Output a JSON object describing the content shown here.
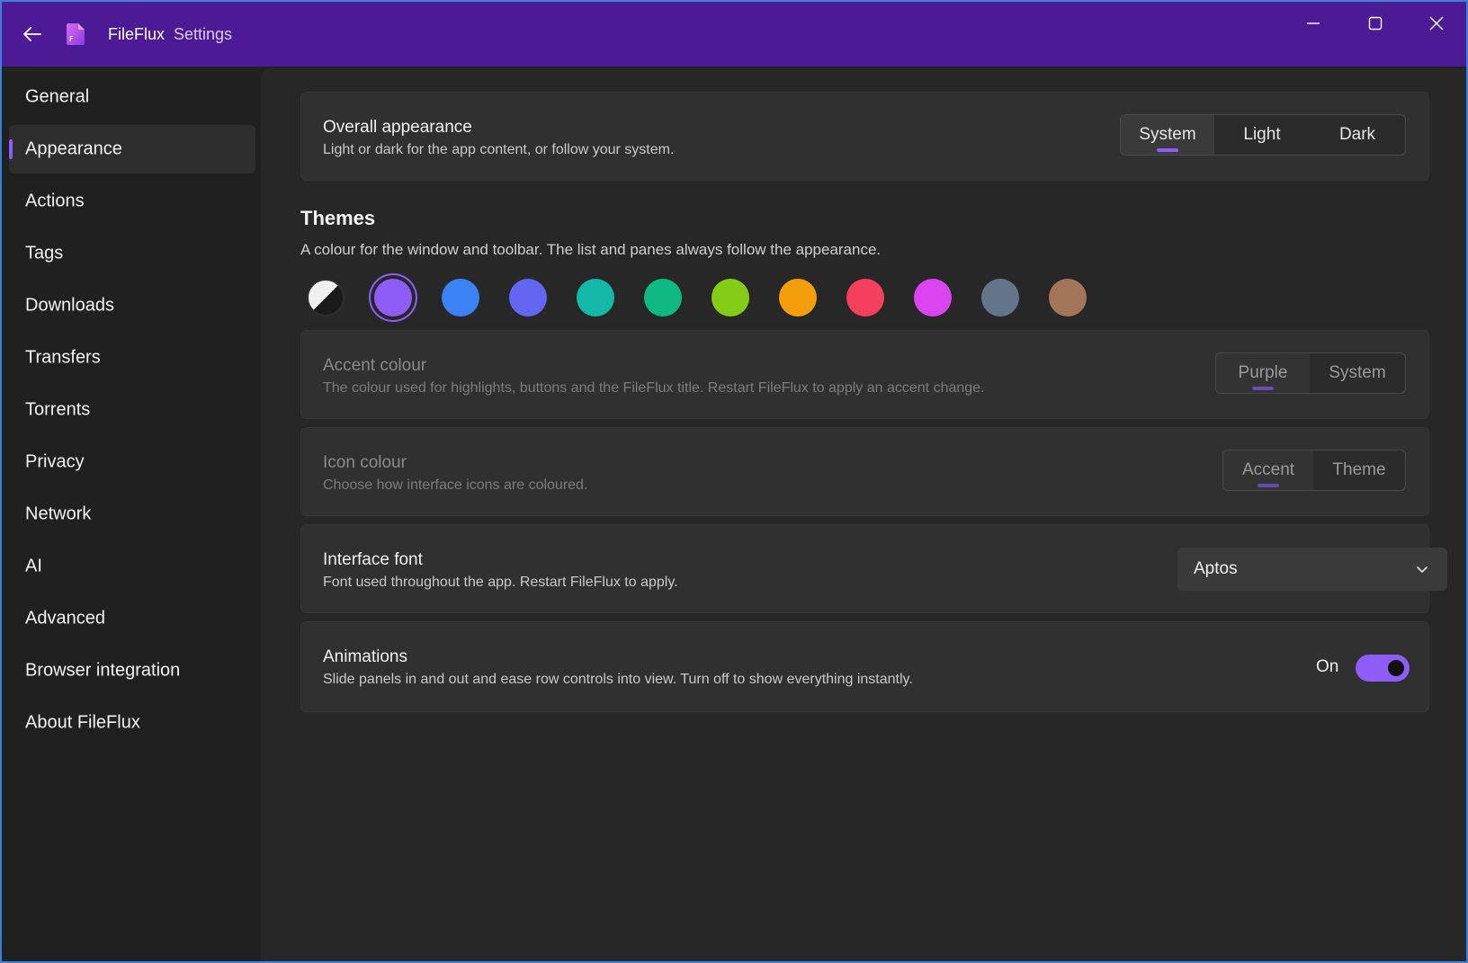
{
  "titlebar": {
    "app_name": "FileFlux",
    "page": "Settings",
    "back_icon": "back-arrow-icon",
    "controls": [
      "minimize-icon",
      "maximize-icon",
      "close-icon"
    ]
  },
  "sidebar": {
    "items": [
      {
        "label": "General",
        "active": false
      },
      {
        "label": "Appearance",
        "active": true
      },
      {
        "label": "Actions",
        "active": false
      },
      {
        "label": "Tags",
        "active": false
      },
      {
        "label": "Downloads",
        "active": false
      },
      {
        "label": "Transfers",
        "active": false
      },
      {
        "label": "Torrents",
        "active": false
      },
      {
        "label": "Privacy",
        "active": false
      },
      {
        "label": "Network",
        "active": false
      },
      {
        "label": "AI",
        "active": false
      },
      {
        "label": "Advanced",
        "active": false
      },
      {
        "label": "Browser integration",
        "active": false
      },
      {
        "label": "About FileFlux",
        "active": false
      }
    ]
  },
  "appearance": {
    "title": "Overall appearance",
    "desc": "Light or dark for the app content, or follow your system.",
    "options": [
      "System",
      "Light",
      "Dark"
    ],
    "selected": "System"
  },
  "themes": {
    "title": "Themes",
    "desc": "A colour for the window and toolbar. The list and panes always follow the appearance.",
    "swatches": [
      {
        "name": "auto-contrast",
        "color": "#f0f0f0"
      },
      {
        "name": "purple",
        "color": "#8e5cf7",
        "selected": true
      },
      {
        "name": "blue",
        "color": "#3b82f6"
      },
      {
        "name": "indigo",
        "color": "#6366f1"
      },
      {
        "name": "teal",
        "color": "#14b8a6"
      },
      {
        "name": "green",
        "color": "#10b981"
      },
      {
        "name": "lime",
        "color": "#84cc16"
      },
      {
        "name": "amber",
        "color": "#f59e0b"
      },
      {
        "name": "rose",
        "color": "#f43f5e"
      },
      {
        "name": "fuchsia",
        "color": "#d946ef"
      },
      {
        "name": "slate",
        "color": "#64748b"
      },
      {
        "name": "brown",
        "color": "#a47659"
      }
    ]
  },
  "accent": {
    "title": "Accent colour",
    "desc": "The colour used for highlights, buttons and the FileFlux title. Restart FileFlux to apply an accent change.",
    "options": [
      "Purple",
      "System"
    ],
    "selected": "Purple"
  },
  "icon_colour": {
    "title": "Icon colour",
    "desc": "Choose how interface icons are coloured.",
    "options": [
      "Accent",
      "Theme"
    ],
    "selected": "Accent"
  },
  "font": {
    "title": "Interface font",
    "desc": "Font used throughout the app. Restart FileFlux to apply.",
    "value": "Aptos",
    "icon": "chevron-down-icon"
  },
  "animations": {
    "title": "Animations",
    "desc": "Slide panels in and out and ease row controls into view. Turn off to show everything instantly.",
    "state_label": "On",
    "enabled": true
  },
  "colors": {
    "titlebar": "#4d1a96",
    "accent": "#8e5cf7"
  }
}
